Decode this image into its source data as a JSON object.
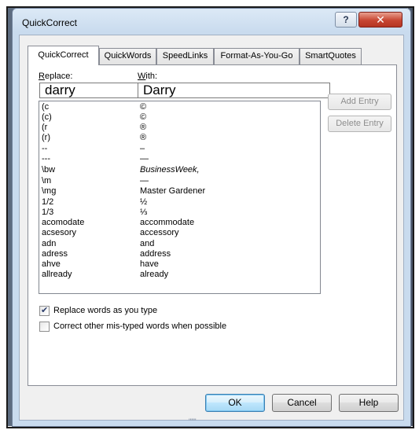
{
  "window": {
    "title": "QuickCorrect",
    "help_glyph": "?",
    "close_glyph": "✕"
  },
  "tabs": [
    {
      "label": "QuickCorrect",
      "active": true
    },
    {
      "label": "QuickWords",
      "active": false
    },
    {
      "label": "SpeedLinks",
      "active": false
    },
    {
      "label": "Format-As-You-Go",
      "active": false
    },
    {
      "label": "SmartQuotes",
      "active": false
    }
  ],
  "form": {
    "replace_label": "Replace:",
    "with_label": "With:",
    "replace_value": "darry",
    "with_value": "Darry"
  },
  "entries": [
    {
      "replace": "(c",
      "with": "©"
    },
    {
      "replace": "(c)",
      "with": "©"
    },
    {
      "replace": "(r",
      "with": "®"
    },
    {
      "replace": "(r)",
      "with": "®"
    },
    {
      "replace": "--",
      "with": "–"
    },
    {
      "replace": "---",
      "with": "—"
    },
    {
      "replace": "\\bw",
      "with": "BusinessWeek,"
    },
    {
      "replace": "\\m",
      "with": "—"
    },
    {
      "replace": "\\mg",
      "with": "Master Gardener"
    },
    {
      "replace": "1/2",
      "with": "½"
    },
    {
      "replace": "1/3",
      "with": "⅓"
    },
    {
      "replace": "acomodate",
      "with": "accommodate"
    },
    {
      "replace": "acsesory",
      "with": "accessory"
    },
    {
      "replace": "adn",
      "with": "and"
    },
    {
      "replace": "adress",
      "with": "address"
    },
    {
      "replace": "ahve",
      "with": "have"
    },
    {
      "replace": "allready",
      "with": "already"
    }
  ],
  "buttons": {
    "add_entry": "Add Entry",
    "delete_entry": "Delete Entry",
    "ok": "OK",
    "cancel": "Cancel",
    "help": "Help"
  },
  "options": {
    "replace_as_type": {
      "label": "Replace words as you type",
      "checked": true
    },
    "correct_mistyped": {
      "label": "Correct other mis-typed words when possible",
      "checked": false
    }
  },
  "scrollbar": {
    "up_glyph": "▲",
    "down_glyph": "▼"
  },
  "grip_glyph": "\"\"\""
}
